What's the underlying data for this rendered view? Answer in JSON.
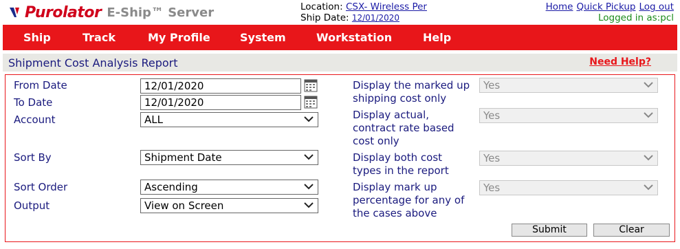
{
  "brand": {
    "name": "Purolator",
    "product": "E-Ship™ Server"
  },
  "location": {
    "label": "Location:",
    "value": "CSX- Wireless Per",
    "ship_label": "Ship Date:",
    "ship_date": "12/01/2020"
  },
  "top_links": {
    "home": "Home",
    "quick_pickup": "Quick Pickup",
    "logout": "Log out",
    "logged_in": "Logged in as:pcl"
  },
  "nav": [
    "Ship",
    "Track",
    "My Profile",
    "System",
    "Workstation",
    "Help"
  ],
  "page": {
    "title": "Shipment Cost Analysis Report",
    "help": "Need Help?"
  },
  "form": {
    "from_date": {
      "label": "From Date",
      "value": "12/01/2020"
    },
    "to_date": {
      "label": "To Date",
      "value": "12/01/2020"
    },
    "account": {
      "label": "Account",
      "value": "ALL"
    },
    "sort_by": {
      "label": "Sort By",
      "value": "Shipment Date"
    },
    "sort_order": {
      "label": "Sort Order",
      "value": "Ascending"
    },
    "output": {
      "label": "Output",
      "value": "View on Screen"
    },
    "marked_up": {
      "label_1": "Display the marked up",
      "label_2": "shipping cost only",
      "value": "Yes"
    },
    "actual": {
      "label_1": "Display actual,",
      "label_2": "contract rate based",
      "label_3": "cost only",
      "value": "Yes"
    },
    "both": {
      "label_1": "Display both cost",
      "label_2": "types in the report",
      "value": "Yes"
    },
    "markup_pct": {
      "label_1": "Display mark up",
      "label_2": "percentage for any of",
      "label_3": "the cases above",
      "value": "Yes"
    }
  },
  "buttons": {
    "submit": "Submit",
    "clear": "Clear"
  },
  "colors": {
    "brand_red": "#e8161a",
    "label_navy": "#1a1a7e",
    "link_blue": "#1a1aa6"
  }
}
